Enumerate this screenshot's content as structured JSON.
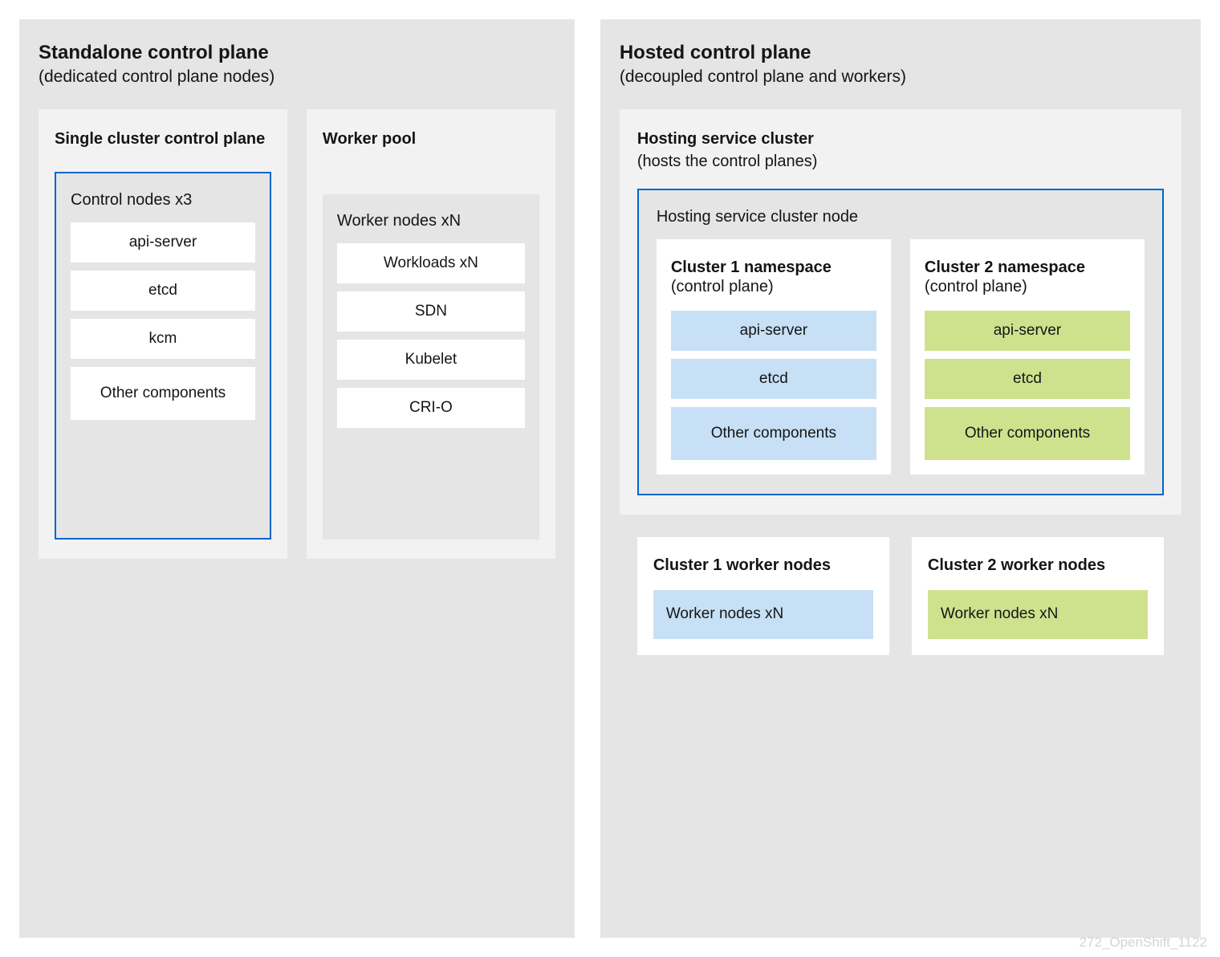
{
  "standalone": {
    "title": "Standalone control plane",
    "subtitle": "(dedicated control plane nodes)",
    "single_cluster": {
      "title": "Single cluster control plane",
      "box_label": "Control nodes  x3",
      "items": [
        "api-server",
        "etcd",
        "kcm",
        "Other components"
      ]
    },
    "worker_pool": {
      "title": "Worker pool",
      "box_label": "Worker nodes  xN",
      "items": [
        "Workloads  xN",
        "SDN",
        "Kubelet",
        "CRI-O"
      ]
    }
  },
  "hosted": {
    "title": "Hosted control plane",
    "subtitle": "(decoupled control plane and workers)",
    "hosting_cluster": {
      "title": "Hosting service cluster",
      "subtitle": "(hosts the control planes)",
      "node_label": "Hosting service cluster node",
      "namespaces": [
        {
          "title": "Cluster 1 namespace",
          "sub": "(control plane)",
          "color": "blue-fill",
          "items": [
            "api-server",
            "etcd",
            "Other components"
          ]
        },
        {
          "title": "Cluster 2 namespace",
          "sub": "(control plane)",
          "color": "green-fill",
          "items": [
            "api-server",
            "etcd",
            "Other components"
          ]
        }
      ]
    },
    "workers": [
      {
        "title": "Cluster 1 worker nodes",
        "label": "Worker nodes  xN",
        "color": "blue-fill"
      },
      {
        "title": "Cluster 2 worker nodes",
        "label": "Worker nodes  xN",
        "color": "green-fill"
      }
    ]
  },
  "watermark": "272_OpenShift_1122"
}
